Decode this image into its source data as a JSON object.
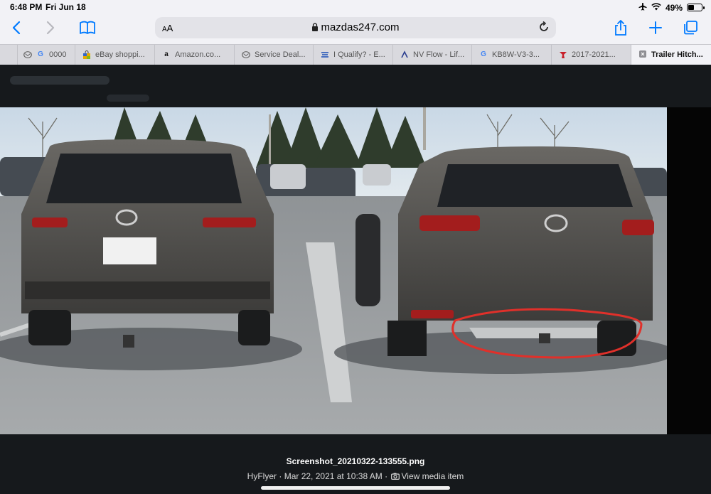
{
  "status": {
    "time": "6:48 PM",
    "date": "Fri Jun 18",
    "battery": "49%",
    "battery_level": 0.49
  },
  "toolbar": {
    "text_size_label": "AA",
    "url": "mazdas247.com"
  },
  "tabs": [
    {
      "label": "",
      "favicon": "mazda-logo-icon"
    },
    {
      "label": "0000",
      "favicon": "google-icon"
    },
    {
      "label": "eBay shoppi...",
      "favicon": "ebay-bag-icon"
    },
    {
      "label": "Amazon.co...",
      "favicon": "amazon-icon"
    },
    {
      "label": "Service Deal...",
      "favicon": "mazda-logo-icon"
    },
    {
      "label": "I Qualify? - E...",
      "favicon": "iqualify-icon"
    },
    {
      "label": "NV Flow - Lif...",
      "favicon": "nvflow-icon"
    },
    {
      "label": "KB8W-V3-3...",
      "favicon": "google-icon"
    },
    {
      "label": "2017-2021...",
      "favicon": "mazda-red-icon"
    },
    {
      "label": "Trailer Hitch...",
      "favicon": "close-icon",
      "active": true
    }
  ],
  "media": {
    "filename": "Screenshot_20210322-133555.png",
    "author": "HyFlyer",
    "separator": "·",
    "datetime": "Mar 22, 2021 at 10:38 AM",
    "view_label": "View media item"
  },
  "colors": {
    "accent": "#007aff",
    "annotation": "#e0302a",
    "page_bg": "#16191c"
  }
}
